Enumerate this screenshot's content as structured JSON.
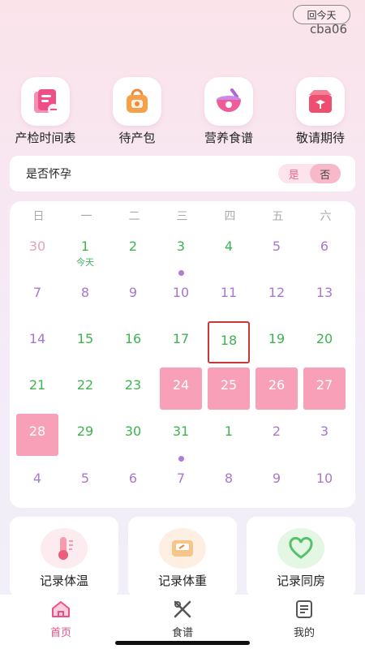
{
  "header": {
    "today_button": "回今天",
    "user_id": "cba06"
  },
  "quick_links": [
    {
      "label": "产检时间表",
      "icon": "checkup-schedule-icon"
    },
    {
      "label": "待产包",
      "icon": "maternity-bag-icon"
    },
    {
      "label": "营养食谱",
      "icon": "nutrition-bowl-icon"
    },
    {
      "label": "敬请期待",
      "icon": "gift-box-icon"
    }
  ],
  "pregnancy": {
    "label": "是否怀孕",
    "yes": "是",
    "no": "否",
    "selected": "否"
  },
  "calendar": {
    "weekdays": [
      "日",
      "一",
      "二",
      "三",
      "四",
      "五",
      "六"
    ],
    "today_sub": "今天",
    "days": [
      {
        "d": "30",
        "t": "grey"
      },
      {
        "d": "1",
        "t": "green",
        "today": true
      },
      {
        "d": "2",
        "t": "green"
      },
      {
        "d": "3",
        "t": "green"
      },
      {
        "d": "4",
        "t": "green"
      },
      {
        "d": "5",
        "t": "purple"
      },
      {
        "d": "6",
        "t": "purple"
      },
      {
        "d": "7",
        "t": "purple"
      },
      {
        "d": "8",
        "t": "purple"
      },
      {
        "d": "9",
        "t": "purple"
      },
      {
        "d": "10",
        "t": "purple",
        "dot": true
      },
      {
        "d": "11",
        "t": "purple"
      },
      {
        "d": "12",
        "t": "purple"
      },
      {
        "d": "13",
        "t": "purple"
      },
      {
        "d": "14",
        "t": "purple"
      },
      {
        "d": "15",
        "t": "green"
      },
      {
        "d": "16",
        "t": "green"
      },
      {
        "d": "17",
        "t": "green"
      },
      {
        "d": "18",
        "t": "green",
        "selected": true
      },
      {
        "d": "19",
        "t": "green"
      },
      {
        "d": "20",
        "t": "green"
      },
      {
        "d": "21",
        "t": "green"
      },
      {
        "d": "22",
        "t": "green"
      },
      {
        "d": "23",
        "t": "green"
      },
      {
        "d": "24",
        "t": "period"
      },
      {
        "d": "25",
        "t": "period"
      },
      {
        "d": "26",
        "t": "period"
      },
      {
        "d": "27",
        "t": "period"
      },
      {
        "d": "28",
        "t": "period"
      },
      {
        "d": "29",
        "t": "green"
      },
      {
        "d": "30",
        "t": "green"
      },
      {
        "d": "31",
        "t": "green"
      },
      {
        "d": "1",
        "t": "green"
      },
      {
        "d": "2",
        "t": "purple"
      },
      {
        "d": "3",
        "t": "purple"
      },
      {
        "d": "4",
        "t": "purple"
      },
      {
        "d": "5",
        "t": "purple"
      },
      {
        "d": "6",
        "t": "purple"
      },
      {
        "d": "7",
        "t": "purple",
        "dot": true
      },
      {
        "d": "8",
        "t": "purple"
      },
      {
        "d": "9",
        "t": "purple"
      },
      {
        "d": "10",
        "t": "purple"
      }
    ]
  },
  "records": [
    {
      "label": "记录体温",
      "icon": "thermometer-icon"
    },
    {
      "label": "记录体重",
      "icon": "scale-icon"
    },
    {
      "label": "记录同房",
      "icon": "heart-icon"
    }
  ],
  "tabbar": [
    {
      "label": "首页",
      "icon": "home-icon",
      "active": true
    },
    {
      "label": "食谱",
      "icon": "utensils-icon",
      "active": false
    },
    {
      "label": "我的",
      "icon": "profile-doc-icon",
      "active": false
    }
  ],
  "colors": {
    "accent": "#f0648c",
    "green": "#3db44f",
    "purple": "#a877cf",
    "period": "#f7a0b8",
    "selected_border": "#c8373a"
  }
}
